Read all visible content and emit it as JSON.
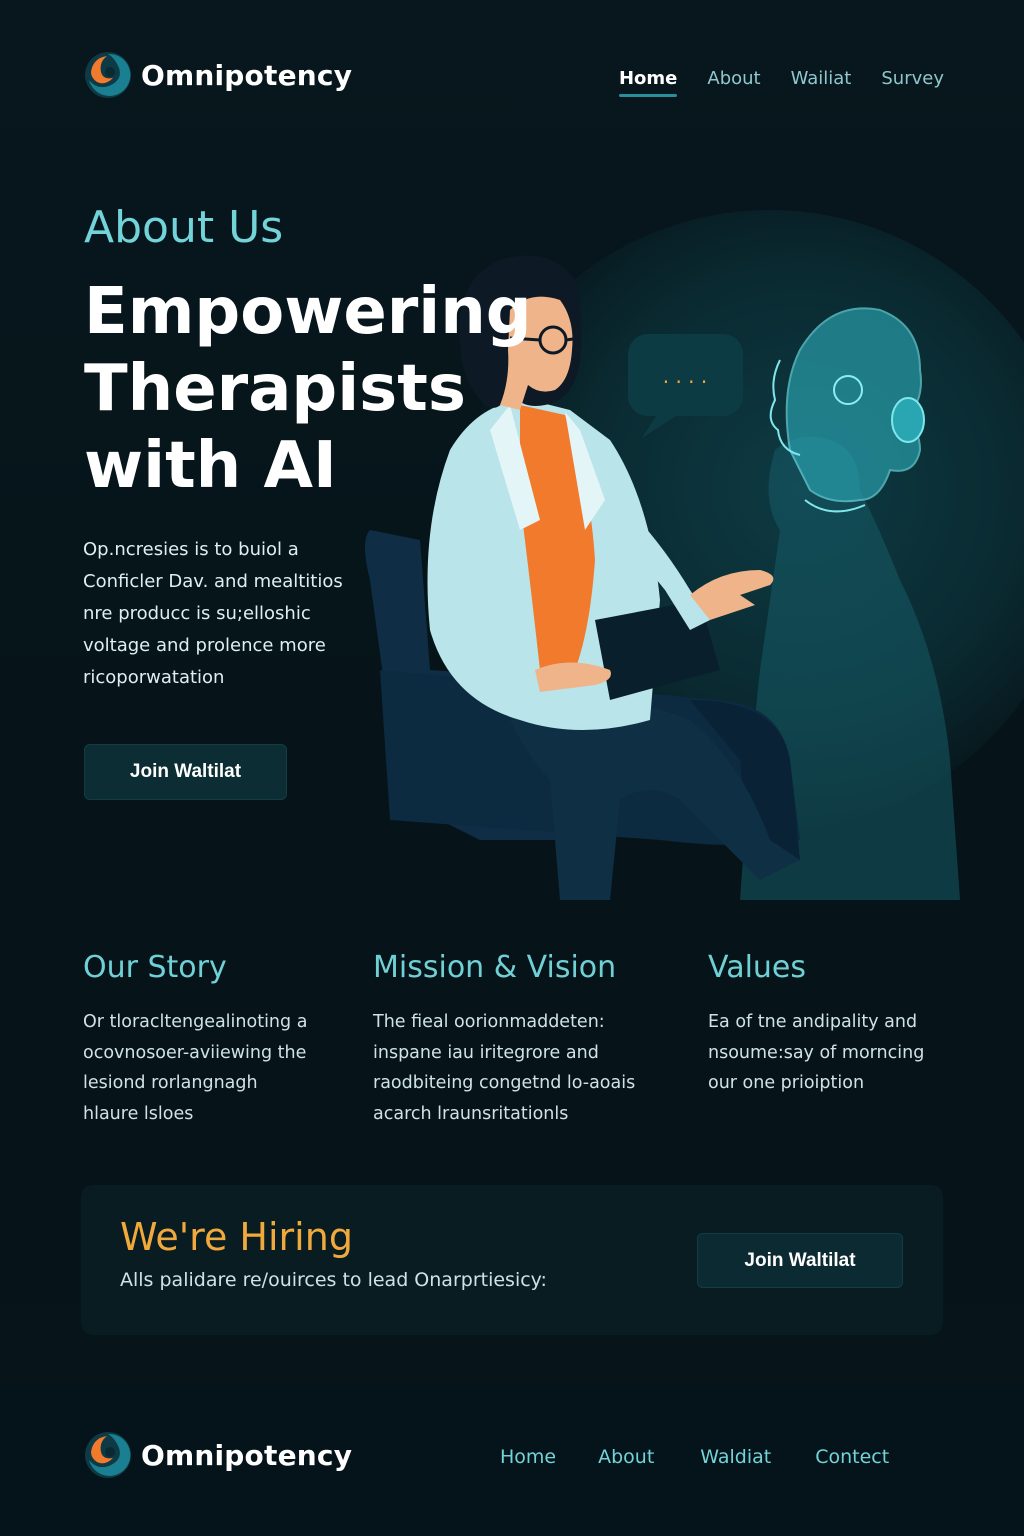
{
  "brand": {
    "name": "Omnipotency"
  },
  "header": {
    "nav": [
      {
        "label": "Home",
        "active": true
      },
      {
        "label": "About"
      },
      {
        "label": "Wailiat"
      },
      {
        "label": "Survey"
      }
    ]
  },
  "hero": {
    "eyebrow": "About Us",
    "title_lines": [
      "Empowering",
      "Therapists",
      "with AI"
    ],
    "body_lines": [
      "Op.ncresies is to buiol a",
      "Conficler Dav. and mealtitios",
      "nre producc is su;elloshic",
      "voltage and prolence more",
      "ricoporwatation"
    ],
    "cta": "Join Waltilat",
    "speech_bubble": ". . . ."
  },
  "features": [
    {
      "title": "Our Story",
      "body_lines": [
        "Or tloracltengealinoting a",
        "ocovnosoer-aviiewing the",
        "lesiond rorlangnagh",
        "hlaure lsloes"
      ]
    },
    {
      "title": "Mission & Vision",
      "body_lines": [
        "The fieal oorionmaddeten:",
        "inspane iau iritegrore and",
        "raodbiteing congetnd lo-aoais",
        "acarch lraunsritationls"
      ]
    },
    {
      "title": "Values",
      "body_lines": [
        "Ea of tne andipality and",
        "nsoume:say of morncing",
        "our one prioiption"
      ]
    }
  ],
  "hiring": {
    "title": "We're Hiring",
    "subtitle": "Alls palidare re/ouirces to lead Onarprtiesicy:",
    "cta": "Join Waltilat"
  },
  "footer": {
    "nav": [
      {
        "label": "Home"
      },
      {
        "label": "About"
      },
      {
        "label": "Waldiat"
      },
      {
        "label": "Contect"
      }
    ]
  },
  "colors": {
    "background": "#06161c",
    "accent_teal": "#72d3d8",
    "accent_orange": "#f2a93b",
    "button_bg": "#0b2d33"
  },
  "icons": {
    "logo": "swirl-logo-icon"
  }
}
